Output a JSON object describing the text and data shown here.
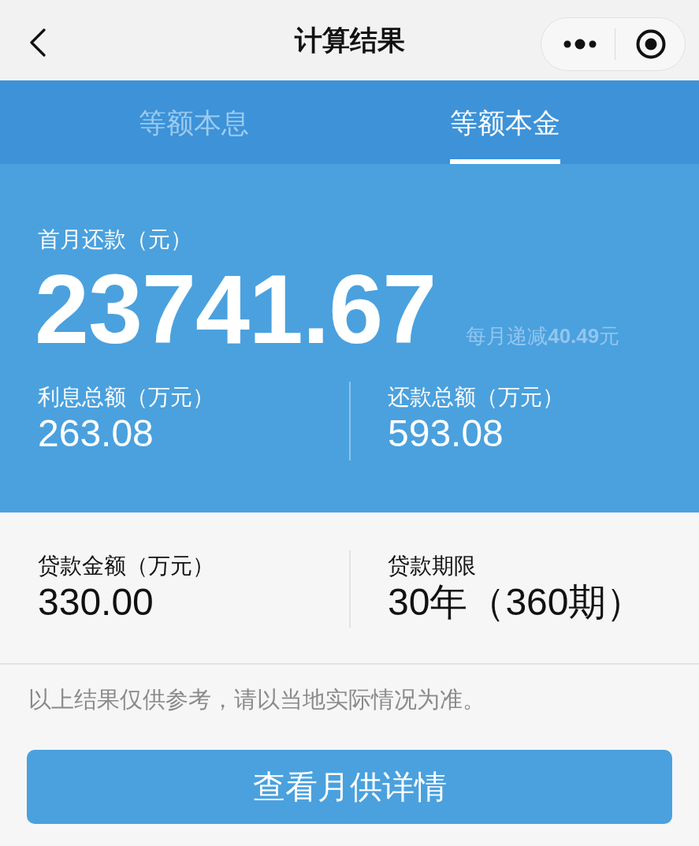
{
  "nav": {
    "title": "计算结果"
  },
  "tabs": [
    {
      "label": "等额本息",
      "selected": false
    },
    {
      "label": "等额本金",
      "selected": true
    }
  ],
  "summary": {
    "label": "首月还款（元）",
    "value": "23741.67",
    "note": "每月递减**40.49**元",
    "stats": [
      {
        "label": "利息总额（万元）",
        "value": "263.08"
      },
      {
        "label": "还款总额（万元）",
        "value": "593.08"
      }
    ]
  },
  "loan": [
    {
      "label": "贷款金额（万元）",
      "value": "330.00"
    },
    {
      "label": "贷款期限",
      "value": "30年（360期）"
    }
  ],
  "disclaimer": "以上结果仅供参考，请以当地实际情况为准。",
  "button": "查看月供详情"
}
